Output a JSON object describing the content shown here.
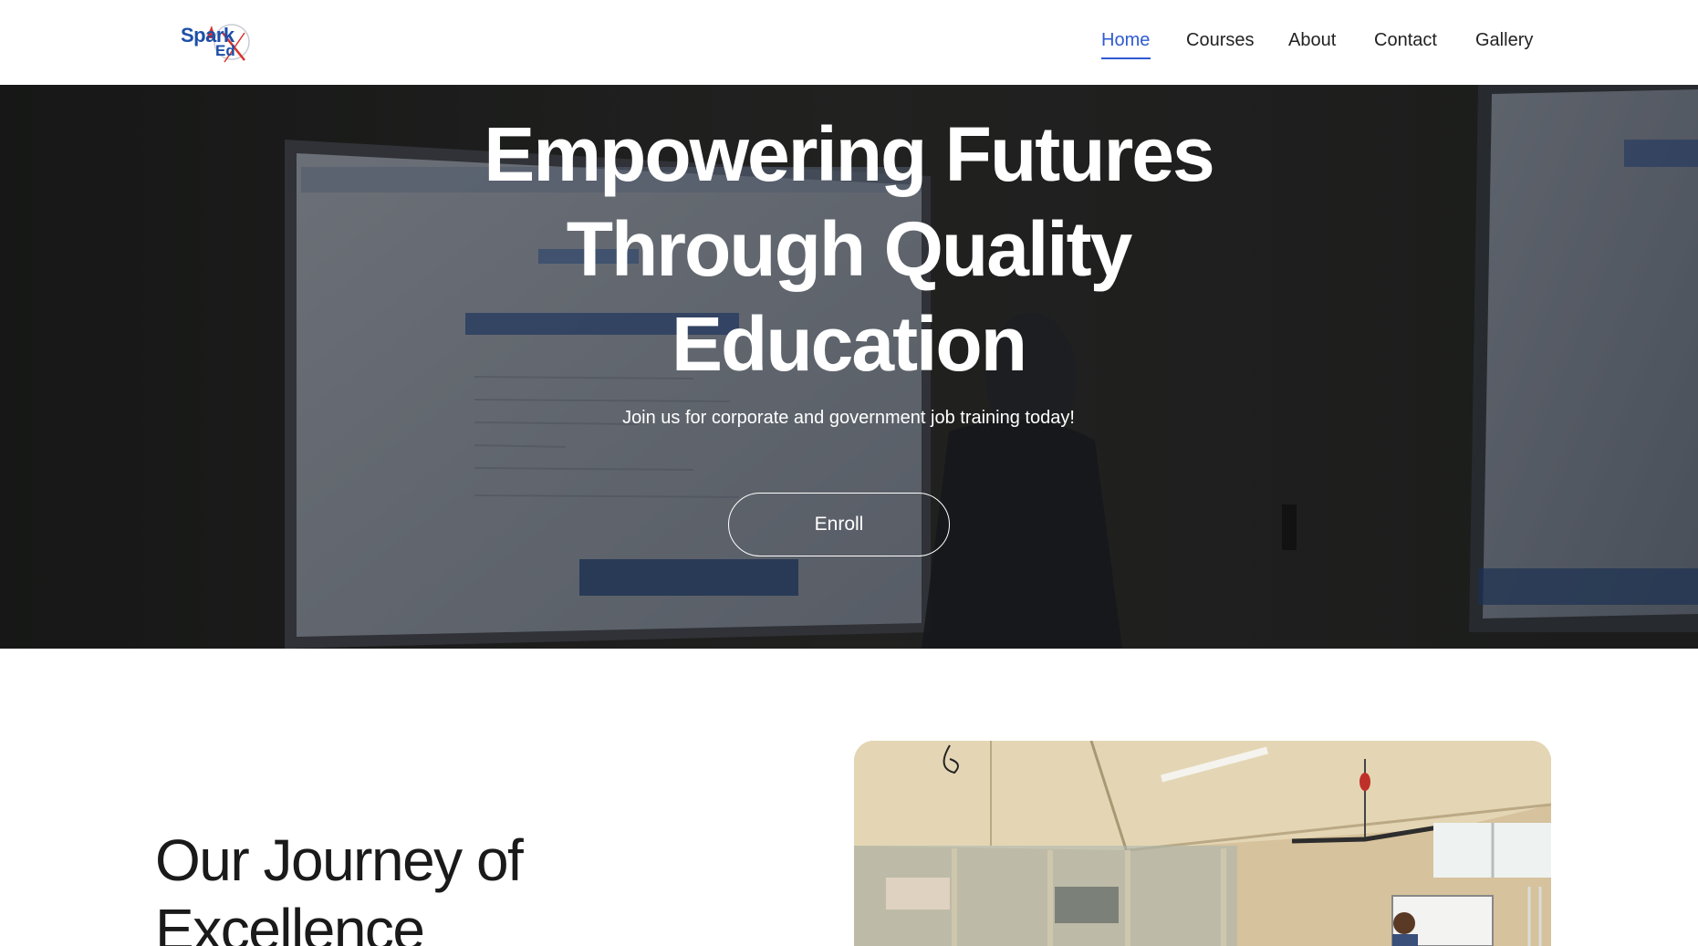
{
  "header": {
    "logo": {
      "name": "spark-edx-logo",
      "text_main": "Spark",
      "text_sub": "Ed"
    },
    "nav": [
      {
        "label": "Home",
        "active": true
      },
      {
        "label": "Courses",
        "active": false
      },
      {
        "label": "About",
        "active": false
      },
      {
        "label": "Contact",
        "active": false
      },
      {
        "label": "Gallery",
        "active": false
      }
    ]
  },
  "hero": {
    "title_lines": [
      "Empowering Futures",
      "Through Quality",
      "Education"
    ],
    "subtitle": "Join us for corporate and government job training today!",
    "cta_label": "Enroll"
  },
  "journey": {
    "title_lines": [
      "Our Journey of",
      "Excellence"
    ]
  },
  "colors": {
    "accent": "#2f5bd3",
    "logo_blue": "#1d4fa8",
    "logo_red": "#d9312b",
    "hero_overlay": "#2b2c2b"
  }
}
